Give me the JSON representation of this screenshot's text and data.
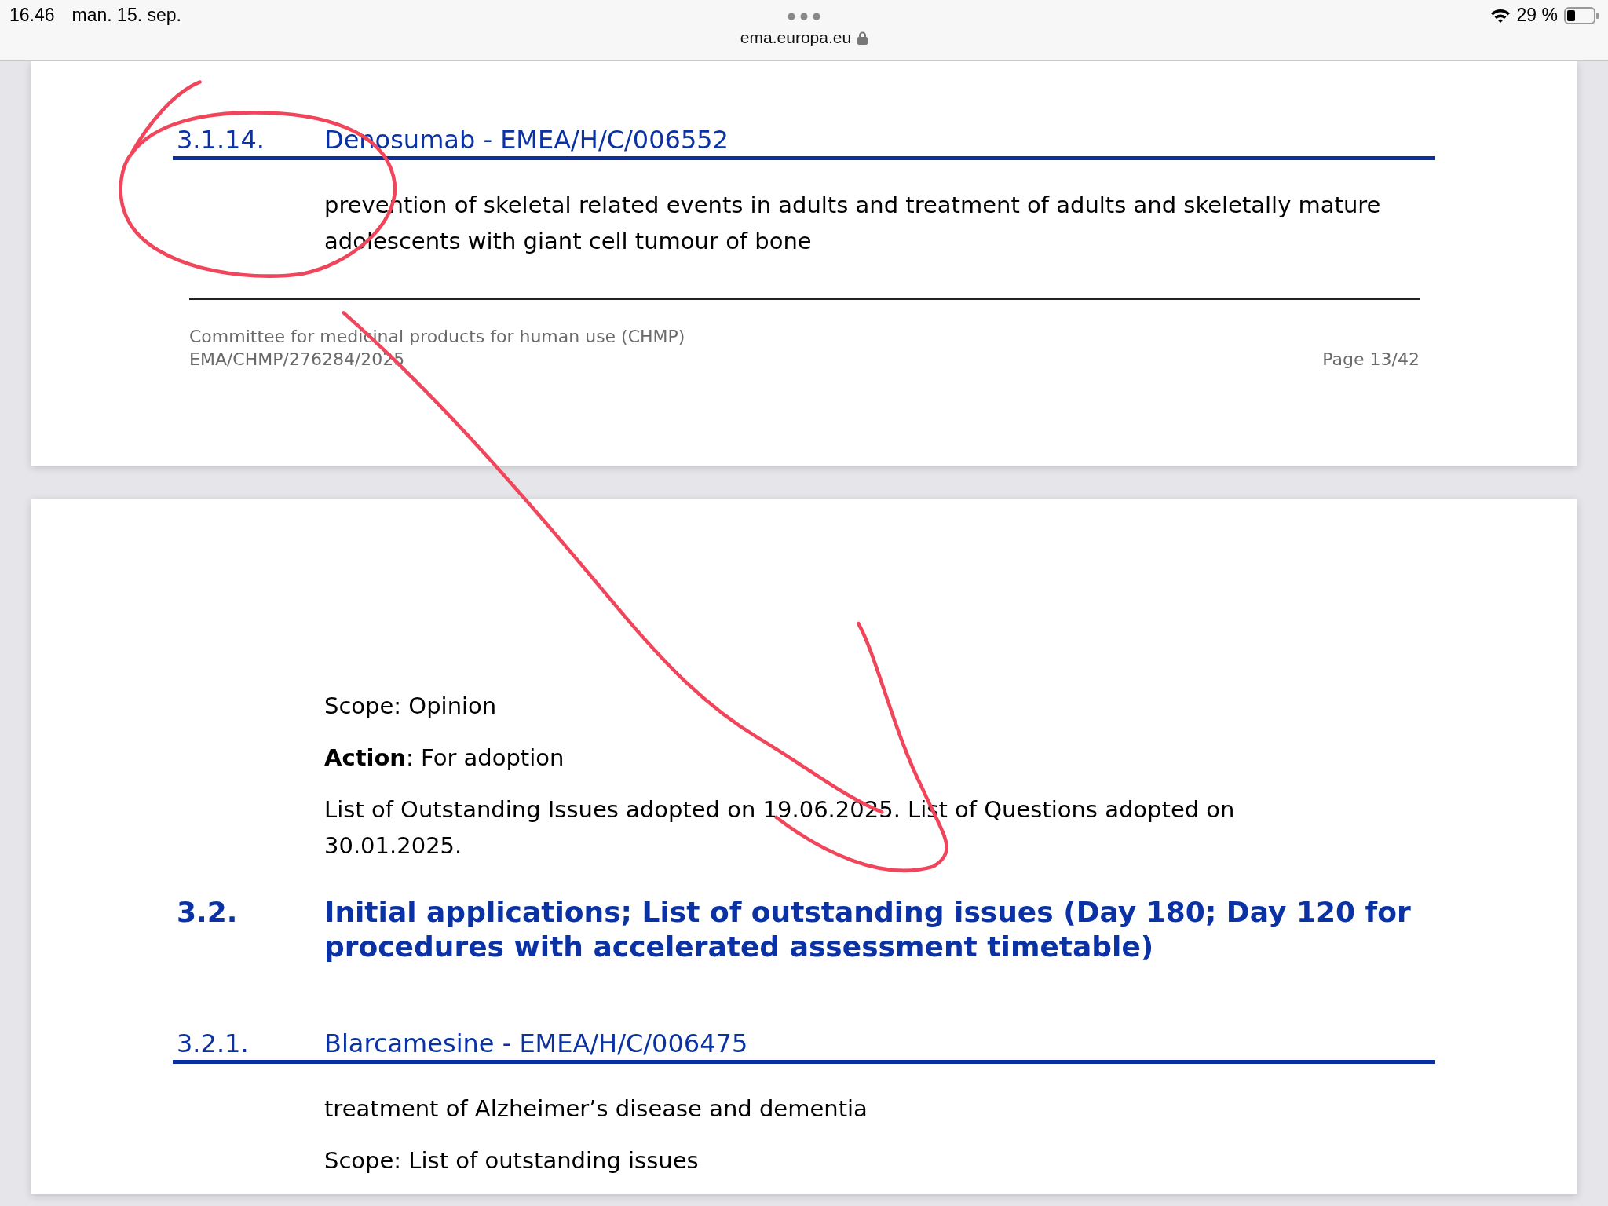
{
  "status_bar": {
    "time": "16.46",
    "date": "man. 15. sep.",
    "battery": "29 %"
  },
  "address_bar": {
    "url": "ema.europa.eu"
  },
  "pages": [
    {
      "blocks": [
        {
          "kind": "subheading",
          "number": "3.1.14.",
          "title": "Denosumab - EMEA/H/C/006552"
        },
        {
          "kind": "paragraph",
          "lines": [
            "prevention of skeletal related events in adults and treatment of adults and skeletally mature",
            "adolescents with giant cell tumour of bone"
          ]
        }
      ],
      "footer": {
        "committee": "Committee for medicinal products for human use (CHMP)",
        "reference": "EMA/CHMP/276284/2025",
        "page": "Page 13/42"
      }
    },
    {
      "blocks": [
        {
          "kind": "paragraph",
          "lines": [
            "Scope: Opinion"
          ]
        },
        {
          "kind": "paragraph",
          "lines": [
            "**Action**: For adoption"
          ]
        },
        {
          "kind": "paragraph",
          "lines": [
            "List of Outstanding Issues adopted on 19.06.2025. List of Questions adopted on",
            "30.01.2025."
          ]
        },
        {
          "kind": "heading",
          "number": "3.2.",
          "lines": [
            "Initial applications; List of outstanding issues (Day 180; Day 120 for",
            "procedures with accelerated assessment timetable)"
          ]
        },
        {
          "kind": "subheading",
          "number": "3.2.1.",
          "title": "Blarcamesine - EMEA/H/C/006475"
        },
        {
          "kind": "paragraph",
          "lines": [
            "treatment of Alzheimer’s disease and dementia"
          ]
        },
        {
          "kind": "paragraph",
          "lines": [
            "Scope: List of outstanding issues"
          ]
        }
      ]
    }
  ]
}
